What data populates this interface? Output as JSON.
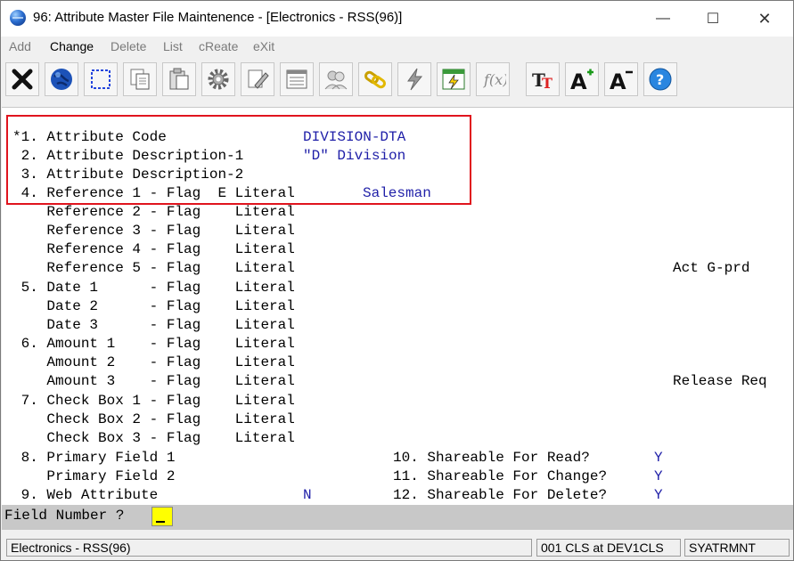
{
  "window": {
    "title": "96: Attribute Master File Maintenence - [Electronics - RSS(96)]",
    "controls": {
      "minimize": "—",
      "maximize": "☐",
      "close": "✕"
    }
  },
  "menu": {
    "items": [
      {
        "label": "Add"
      },
      {
        "label": "Change"
      },
      {
        "label": "Delete"
      },
      {
        "label": "List"
      },
      {
        "label": "cReate"
      },
      {
        "label": "eXit"
      }
    ]
  },
  "toolbar": {
    "icons": [
      "close-icon",
      "globe-icon",
      "select-icon",
      "copy-icon",
      "paste-icon",
      "settings-icon",
      "edit-icon",
      "list-icon",
      "people-icon",
      "link-icon",
      "lightning-icon",
      "calendar-icon",
      "function-icon",
      "font-icon",
      "font-increase-icon",
      "font-decrease-icon",
      "help-icon"
    ]
  },
  "form": {
    "lines": [
      {
        "text": "*1. Attribute Code",
        "value": "DIVISION-DTA"
      },
      {
        "text": " 2. Attribute Description-1",
        "value": "\"D\" Division"
      },
      {
        "text": " 3. Attribute Description-2",
        "value": ""
      },
      {
        "text": " 4. Reference 1 - Flag  E Literal",
        "value": "Salesman"
      },
      {
        "text": "    Reference 2 - Flag    Literal",
        "value": ""
      },
      {
        "text": "    Reference 3 - Flag    Literal",
        "value": ""
      },
      {
        "text": "    Reference 4 - Flag    Literal",
        "value": ""
      },
      {
        "text": "    Reference 5 - Flag    Literal",
        "value": ""
      },
      {
        "text": " 5. Date 1      - Flag    Literal",
        "value": ""
      },
      {
        "text": "    Date 2      - Flag    Literal",
        "value": ""
      },
      {
        "text": "    Date 3      - Flag    Literal",
        "value": ""
      },
      {
        "text": " 6. Amount 1    - Flag    Literal",
        "value": ""
      },
      {
        "text": "    Amount 2    - Flag    Literal",
        "value": ""
      },
      {
        "text": "    Amount 3    - Flag    Literal",
        "value": ""
      },
      {
        "text": " 7. Check Box 1 - Flag    Literal",
        "value": ""
      },
      {
        "text": "    Check Box 2 - Flag    Literal",
        "value": ""
      },
      {
        "text": "    Check Box 3 - Flag    Literal",
        "value": ""
      },
      {
        "text": " 8. Primary Field 1",
        "value": ""
      },
      {
        "text": "    Primary Field 2",
        "value": ""
      },
      {
        "text": " 9. Web Attribute",
        "value": "N"
      }
    ],
    "right_notes": {
      "act": "Act G-prd",
      "release": "Release Req"
    },
    "shareable": [
      {
        "label": "10. Shareable For Read?",
        "value": "Y"
      },
      {
        "label": "11. Shareable For Change?",
        "value": "Y"
      },
      {
        "label": "12. Shareable For Delete?",
        "value": "Y"
      }
    ]
  },
  "prompt": {
    "label": "Field Number ?",
    "value": ""
  },
  "status": {
    "company": "Electronics - RSS(96)",
    "session": "001 CLS at DEV1CLS",
    "program": "SYATRMNT"
  }
}
